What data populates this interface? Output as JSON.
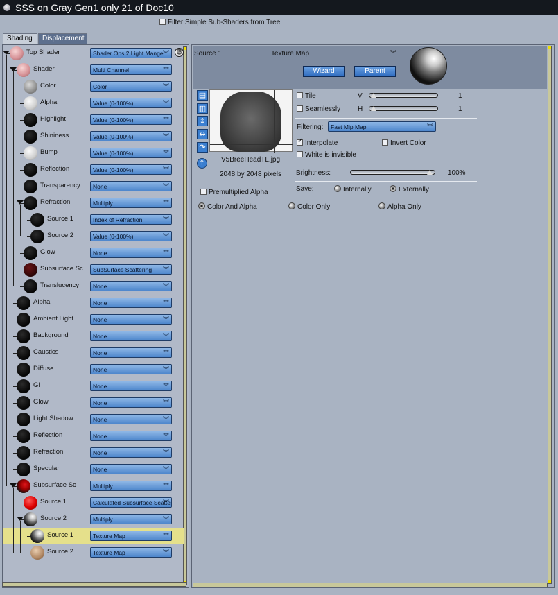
{
  "window": {
    "title": "SSS on Gray Gen1 only 21 of Doc10"
  },
  "filter": {
    "label": "Filter Simple Sub-Shaders from Tree",
    "checked": false
  },
  "tabs": [
    {
      "label": "Shading",
      "active": true
    },
    {
      "label": "Displacement",
      "active": false
    }
  ],
  "tree": [
    {
      "label": "Top Shader",
      "value": "Shader Ops 2 Light Manger",
      "ball": "pink-sphere",
      "selected": false
    },
    {
      "label": "Shader",
      "value": "Multi Channel",
      "ball": "pink-sphere",
      "selected": false
    },
    {
      "label": "Color",
      "value": "Color",
      "ball": "gray-sphere",
      "selected": false
    },
    {
      "label": "Alpha",
      "value": "Value (0-100%)",
      "ball": "light-gray-sphere",
      "selected": false
    },
    {
      "label": "Highlight",
      "value": "Value (0-100%)",
      "ball": "black-sphere",
      "selected": false
    },
    {
      "label": "Shininess",
      "value": "Value (0-100%)",
      "ball": "black-sphere",
      "selected": false
    },
    {
      "label": "Bump",
      "value": "Value (0-100%)",
      "ball": "light-gray-sphere",
      "selected": false
    },
    {
      "label": "Reflection",
      "value": "Value (0-100%)",
      "ball": "black-sphere",
      "selected": false
    },
    {
      "label": "Transparency",
      "value": "None",
      "ball": "black-sphere",
      "selected": false
    },
    {
      "label": "Refraction",
      "value": "Multiply",
      "ball": "black-sphere",
      "selected": false
    },
    {
      "label": "Source 1",
      "value": "Index of Refraction",
      "ball": "black-sphere",
      "selected": false
    },
    {
      "label": "Source 2",
      "value": "Value (0-100%)",
      "ball": "black-sphere",
      "selected": false
    },
    {
      "label": "Glow",
      "value": "None",
      "ball": "black-sphere",
      "selected": false
    },
    {
      "label": "Subsurface Sc",
      "value": "SubSurface Scattering",
      "ball": "dark-red-sphere",
      "selected": false
    },
    {
      "label": "Translucency",
      "value": "None",
      "ball": "black-sphere",
      "selected": false
    },
    {
      "label": "Alpha",
      "value": "None",
      "ball": "black-sphere",
      "selected": false
    },
    {
      "label": "Ambient Light",
      "value": "None",
      "ball": "black-sphere",
      "selected": false
    },
    {
      "label": "Background",
      "value": "None",
      "ball": "black-sphere",
      "selected": false
    },
    {
      "label": "Caustics",
      "value": "None",
      "ball": "black-sphere",
      "selected": false
    },
    {
      "label": "Diffuse",
      "value": "None",
      "ball": "black-sphere",
      "selected": false
    },
    {
      "label": "GI",
      "value": "None",
      "ball": "black-sphere",
      "selected": false
    },
    {
      "label": "Glow",
      "value": "None",
      "ball": "black-sphere",
      "selected": false
    },
    {
      "label": "Light Shadow",
      "value": "None",
      "ball": "black-sphere",
      "selected": false
    },
    {
      "label": "Reflection",
      "value": "None",
      "ball": "black-sphere",
      "selected": false
    },
    {
      "label": "Refraction",
      "value": "None",
      "ball": "black-sphere",
      "selected": false
    },
    {
      "label": "Specular",
      "value": "None",
      "ball": "black-sphere",
      "selected": false
    },
    {
      "label": "Subsurface Sc",
      "value": "Multiply",
      "ball": "red-black-sphere",
      "selected": false
    },
    {
      "label": "Source 1",
      "value": "Calculated Subsurface Scattering",
      "ball": "red-sphere",
      "selected": false
    },
    {
      "label": "Source 2",
      "value": "Multiply",
      "ball": "bw-sphere",
      "selected": false
    },
    {
      "label": "Source 1",
      "value": "Texture Map",
      "ball": "bw-sphere",
      "selected": true
    },
    {
      "label": "Source 2",
      "value": "Texture Map",
      "ball": "tan-sphere",
      "selected": false
    }
  ],
  "right": {
    "header_label": "Source 1",
    "header_type": "Texture Map",
    "wizard_label": "Wizard",
    "parent_label": "Parent",
    "filename": "V5BreeHeadTL.jpg",
    "dimensions": "2048 by 2048 pixels",
    "tile_label": "Tile",
    "seamlessly_label": "Seamlessly",
    "v_label": "V",
    "h_label": "H",
    "v_value": "1",
    "h_value": "1",
    "filtering_label": "Filtering:",
    "filtering_value": "Fast Mip Map",
    "interpolate_label": "Interpolate",
    "invert_label": "Invert Color",
    "white_invisible_label": "White is invisible",
    "brightness_label": "Brightness:",
    "brightness_value": "100%",
    "save_label": "Save:",
    "internally_label": "Internally",
    "externally_label": "Externally",
    "premult_label": "Premultiplied Alpha",
    "color_alpha_label": "Color And Alpha",
    "color_only_label": "Color Only",
    "alpha_only_label": "Alpha Only"
  }
}
